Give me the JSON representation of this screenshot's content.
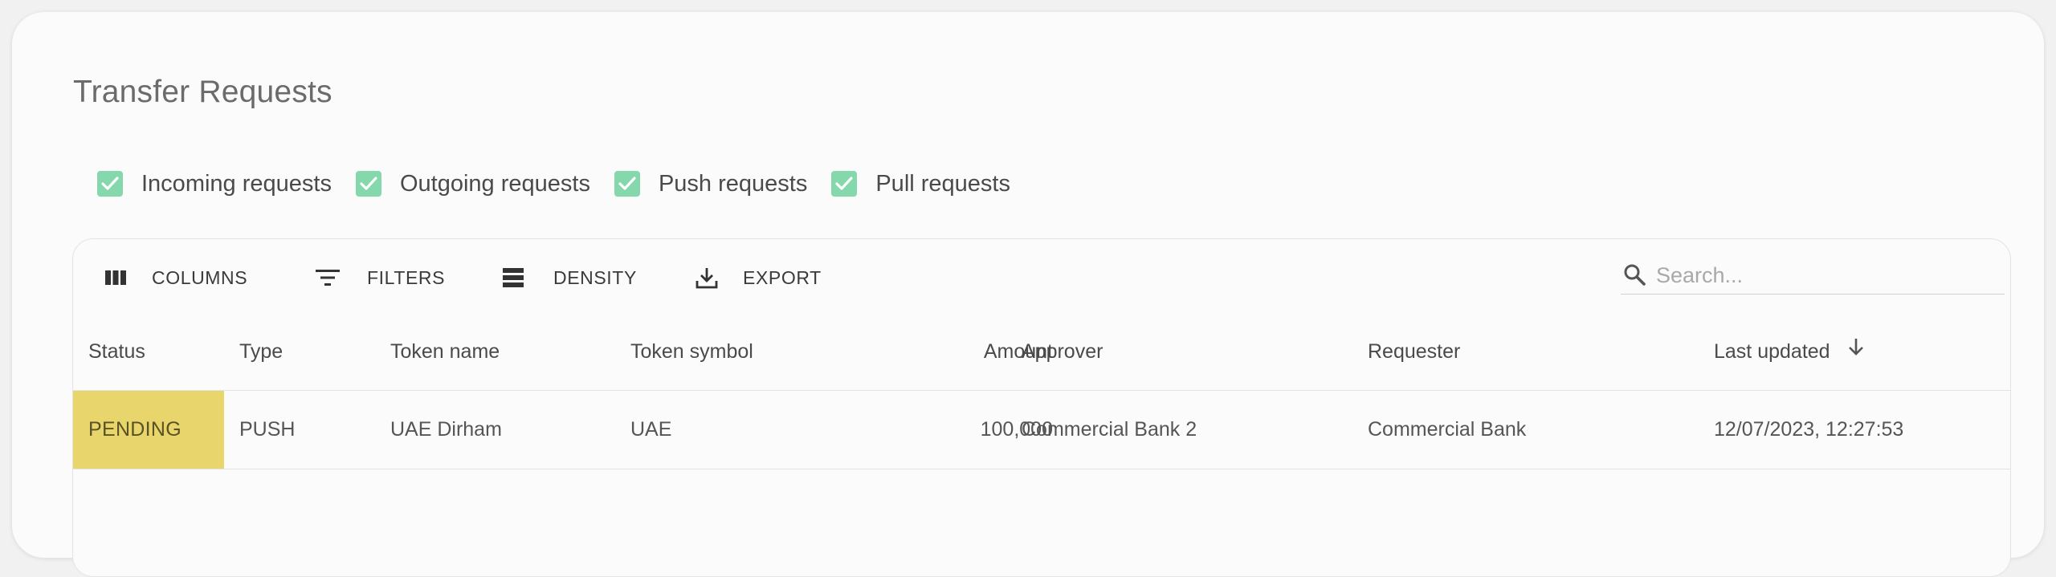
{
  "page": {
    "title": "Transfer Requests"
  },
  "filters": [
    {
      "label": "Incoming requests",
      "checked": true
    },
    {
      "label": "Outgoing requests",
      "checked": true
    },
    {
      "label": "Push requests",
      "checked": true
    },
    {
      "label": "Pull requests",
      "checked": true
    }
  ],
  "toolbar": {
    "columns_label": "COLUMNS",
    "filters_label": "FILTERS",
    "density_label": "DENSITY",
    "export_label": "EXPORT",
    "search_placeholder": "Search..."
  },
  "table": {
    "columns": [
      "Status",
      "Type",
      "Token name",
      "Token symbol",
      "Amount",
      "Approver",
      "Requester",
      "Last updated"
    ],
    "sort_column": "Last updated",
    "sort_direction": "descending",
    "rows": [
      {
        "status": "PENDING",
        "type": "PUSH",
        "token_name": "UAE Dirham",
        "token_symbol": "UAE",
        "amount": "100,000",
        "approver": "Commercial Bank 2",
        "requester": "Commercial Bank",
        "last_updated": "12/07/2023, 12:27:53"
      }
    ]
  },
  "colors": {
    "checkbox": "#84d8ab",
    "pending_status": "#e8d56b",
    "card_background": "#fbfbfb"
  },
  "icons": {
    "columns": "view-column-icon",
    "filters": "filter-list-icon",
    "density": "density-icon",
    "export": "download-icon",
    "search": "search-icon",
    "sort": "arrow-down-icon",
    "checkbox": "check-icon"
  }
}
